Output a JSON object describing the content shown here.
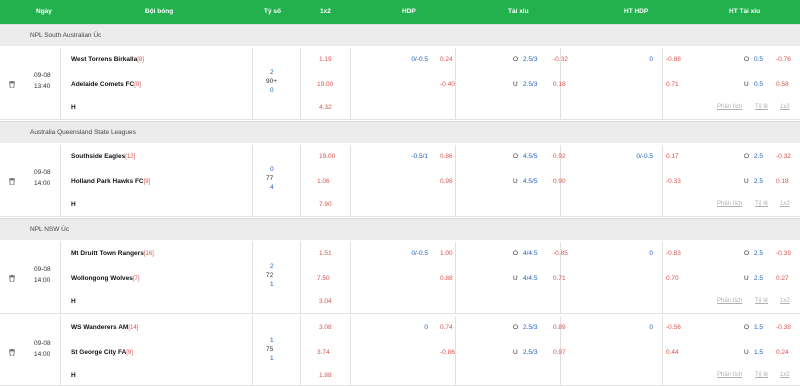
{
  "header": {
    "cols": [
      "Ngày",
      "Đội bóng",
      "Tỷ số",
      "1x2",
      "HDP",
      "Tài xỉu",
      "HT HDP",
      "HT Tài xỉu"
    ]
  },
  "leagues": [
    "NPL South Australian Úc",
    "Australia Queensland State Leagues",
    "NPL NSW Úc"
  ],
  "links": {
    "analysis": "Phân tích",
    "ratio": "Tỷ lệ",
    "one_x_two": "1x2"
  },
  "draw_label": "H",
  "matches": [
    {
      "date": "09-08",
      "time": "13:40",
      "home": "West Torrens Birkalla",
      "home_rank": "[8]",
      "away": "Adelaide Comets FC",
      "away_rank": "[9]",
      "score_home": "2",
      "minute": "90+",
      "score_away": "0",
      "x_home": "1.19",
      "x_away": "19.00",
      "x_draw": "4.32",
      "hdp_line": "0/-0.5",
      "hdp_home": "0.24",
      "hdp_away": "-0.40",
      "ou_o": "O",
      "ou_line1": "2.5/3",
      "ou_home": "-0.32",
      "ou_u": "U",
      "ou_line2": "2.5/3",
      "ou_away": "0.18",
      "hthdp_line": "0",
      "hthdp_home": "-0.88",
      "hthdp_away": "0.71",
      "htou_o": "O",
      "htou_line1": "0.5",
      "htou_home": "-0.76",
      "htou_u": "U",
      "htou_line2": "0.5",
      "htou_away": "0.58"
    },
    {
      "date": "09-08",
      "time": "14:00",
      "home": "Southside Eagles",
      "home_rank": "[12]",
      "away": "Holland Park Hawks FC",
      "away_rank": "[9]",
      "score_home": "0",
      "minute": "77",
      "score_away": "4",
      "x_home": "19.00",
      "x_away": "1.06",
      "x_draw": "7.90",
      "hdp_line": "-0.5/1",
      "hdp_home": "0.86",
      "hdp_away": "0.98",
      "ou_o": "O",
      "ou_line1": "4.5/5",
      "ou_home": "0.92",
      "ou_u": "U",
      "ou_line2": "4.5/5",
      "ou_away": "0.90",
      "hthdp_line": "0/-0.5",
      "hthdp_home": "0.17",
      "hthdp_away": "-0.33",
      "htou_o": "O",
      "htou_line1": "2.5",
      "htou_home": "-0.32",
      "htou_u": "U",
      "htou_line2": "2.5",
      "htou_away": "0.18"
    },
    {
      "date": "09-08",
      "time": "14:00",
      "home": "Mt Druitt Town Rangers",
      "home_rank": "[16]",
      "away": "Wollongong Wolves",
      "away_rank": "[7]",
      "score_home": "2",
      "minute": "72",
      "score_away": "1",
      "x_home": "1.51",
      "x_away": "7.50",
      "x_draw": "3.04",
      "hdp_line": "0/-0.5",
      "hdp_home": "1.00",
      "hdp_away": "0.88",
      "ou_o": "O",
      "ou_line1": "4/4.5",
      "ou_home": "-0.85",
      "ou_u": "U",
      "ou_line2": "4/4.5",
      "ou_away": "0.71",
      "hthdp_line": "0",
      "hthdp_home": "-0.83",
      "hthdp_away": "0.70",
      "htou_o": "O",
      "htou_line1": "2.5",
      "htou_home": "-0.39",
      "htou_u": "U",
      "htou_line2": "2.5",
      "htou_away": "0.27"
    },
    {
      "date": "09-08",
      "time": "14:00",
      "home": "WS Wanderers AM",
      "home_rank": "[14]",
      "away": "St George City FA",
      "away_rank": "[9]",
      "score_home": "1",
      "minute": "75",
      "score_away": "1",
      "x_home": "3.08",
      "x_away": "3.74",
      "x_draw": "1.88",
      "hdp_line": "0",
      "hdp_home": "0.74",
      "hdp_away": "-0.86",
      "ou_o": "O",
      "ou_line1": "2.5/3",
      "ou_home": "0.89",
      "ou_u": "U",
      "ou_line2": "2.5/3",
      "ou_away": "0.97",
      "hthdp_line": "0",
      "hthdp_home": "-0.56",
      "hthdp_away": "0.44",
      "htou_o": "O",
      "htou_line1": "1.5",
      "htou_home": "-0.38",
      "htou_u": "U",
      "htou_line2": "1.5",
      "htou_away": "0.24"
    }
  ],
  "colors": {
    "header": "#22b14c",
    "accent_red": "#d9534f",
    "accent_blue": "#1f5fbf"
  }
}
